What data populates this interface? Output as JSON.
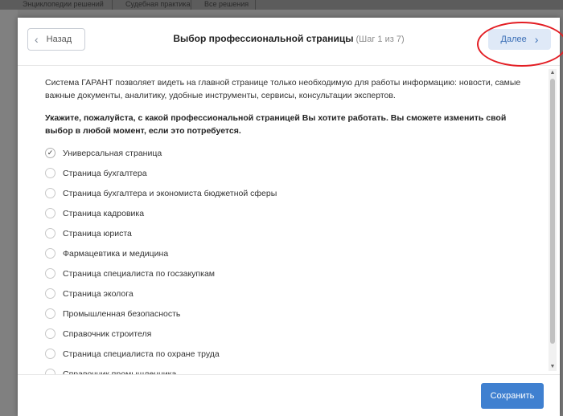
{
  "background": {
    "tabs": [
      "Энциклопедии решений",
      "Судебная практика",
      "Все решения"
    ]
  },
  "header": {
    "back_label": "Назад",
    "title": "Выбор профессиональной страницы",
    "step": "(Шаг 1 из 7)",
    "next_label": "Далее"
  },
  "body": {
    "intro": "Система ГАРАНТ позволяет видеть на главной странице только необходимую для работы информацию: новости, самые важные документы, аналитику, удобные инструменты, сервисы, консультации экспертов.",
    "question": "Укажите, пожалуйста, с какой профессиональной страницей Вы хотите работать. Вы сможете изменить свой выбор в любой момент, если это потребуется.",
    "options": [
      {
        "label": "Универсальная страница",
        "checked": true
      },
      {
        "label": "Страница бухгалтера",
        "checked": false
      },
      {
        "label": "Страница бухгалтера и экономиста бюджетной сферы",
        "checked": false
      },
      {
        "label": "Страница кадровика",
        "checked": false
      },
      {
        "label": "Страница юриста",
        "checked": false
      },
      {
        "label": "Фармацевтика и медицина",
        "checked": false
      },
      {
        "label": "Страница специалиста по госзакупкам",
        "checked": false
      },
      {
        "label": "Страница эколога",
        "checked": false
      },
      {
        "label": "Промышленная безопасность",
        "checked": false
      },
      {
        "label": "Справочник строителя",
        "checked": false
      },
      {
        "label": "Страница специалиста по охране труда",
        "checked": false
      },
      {
        "label": "Справочник промышленника",
        "checked": false
      }
    ]
  },
  "footer": {
    "save_label": "Сохранить"
  },
  "colors": {
    "accent": "#3f80d0",
    "next_bg": "#dfe9f7",
    "annotation": "#e31e24"
  },
  "icons": {
    "back": "chevron-left-icon",
    "next": "chevron-right-icon",
    "check": "checkmark-icon"
  }
}
